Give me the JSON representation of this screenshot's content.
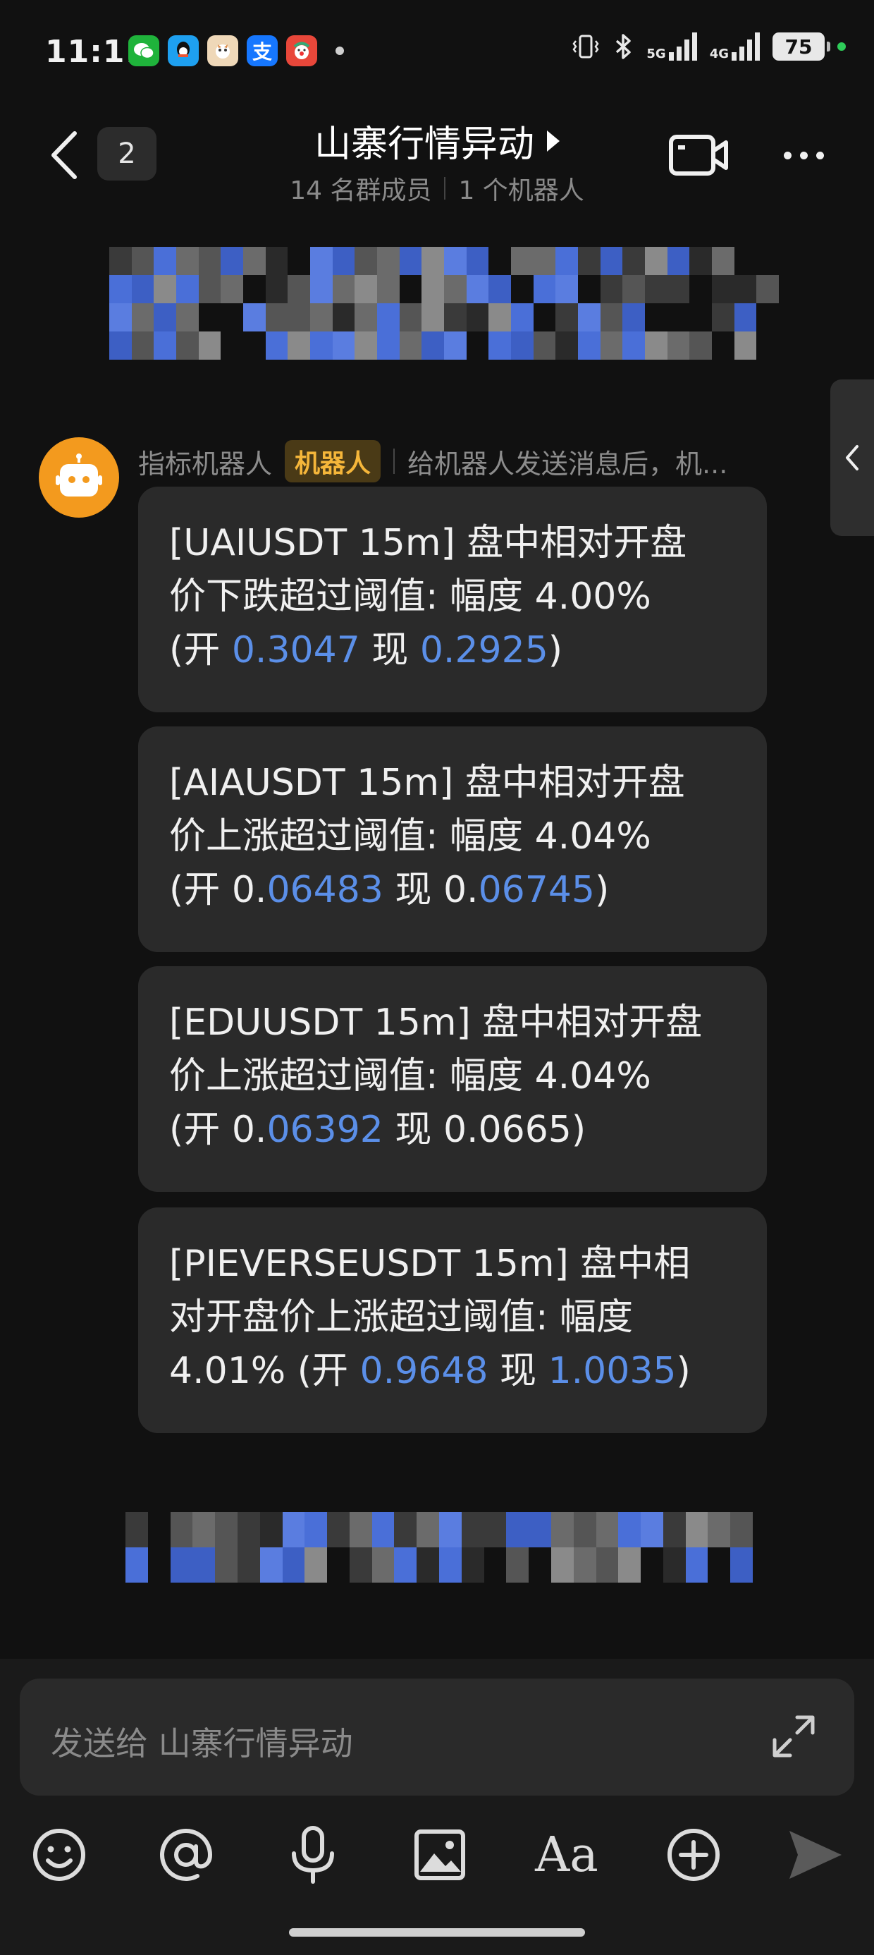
{
  "status_bar": {
    "time": "11:11",
    "apps": [
      {
        "icon": "wechat-icon",
        "color": "#1fb33b",
        "glyph": "●"
      },
      {
        "icon": "qq-icon",
        "color": "#1ea0f0",
        "glyph": "◉"
      },
      {
        "icon": "game-app-icon",
        "color": "#e9d3b5",
        "glyph": "▲"
      },
      {
        "icon": "alipay-icon",
        "color": "#1677ff",
        "glyph": "支"
      },
      {
        "icon": "clown-app-icon",
        "color": "#e8473a",
        "glyph": "☻"
      }
    ],
    "network_1": "5G",
    "network_2": "4G",
    "battery": "75"
  },
  "header": {
    "unread_count": "2",
    "title": "山寨行情异动",
    "member_count": "14 名群成员",
    "bot_count": "1 个机器人"
  },
  "sender": {
    "name": "指标机器人",
    "badge": "机器人",
    "note": "给机器人发送消息后，机..."
  },
  "messages": [
    {
      "line1": "[UAIUSDT 15m] 盘中相对开盘",
      "line2": "价下跌超过阈值: 幅度 4.00%",
      "line3_prefix": "(开 ",
      "open_plain": "",
      "open_link": "0.3047",
      "mid": " 现 ",
      "now_plain": "",
      "now_link": "0.2925",
      "suffix": ")"
    },
    {
      "line1": "[AIAUSDT 15m] 盘中相对开盘",
      "line2": "价上涨超过阈值: 幅度 4.04%",
      "line3_prefix": "(开 ",
      "open_plain": "0.",
      "open_link": "06483",
      "mid": " 现 ",
      "now_plain": "0.",
      "now_link": "06745",
      "suffix": ")"
    },
    {
      "line1": "[EDUUSDT 15m] 盘中相对开盘",
      "line2": "价上涨超过阈值: 幅度 4.04%",
      "line3_prefix": "(开 ",
      "open_plain": "0.",
      "open_link": "06392",
      "mid": " 现 ",
      "now_plain": "0.0665",
      "now_link": "",
      "suffix": ")"
    },
    {
      "line1": "[PIEVERSEUSDT 15m] 盘中相",
      "line2": "对开盘价上涨超过阈值: 幅度",
      "line3_prefix": "4.01% (开 ",
      "open_plain": "",
      "open_link": "0.9648",
      "mid": " 现 ",
      "now_plain": "",
      "now_link": "1.0035",
      "suffix": ")"
    }
  ],
  "composer": {
    "placeholder": "发送给 山寨行情异动",
    "toolbar": [
      "emoji-icon",
      "mention-icon",
      "microphone-icon",
      "image-icon",
      "text-format-icon",
      "add-icon",
      "send-icon"
    ],
    "text_format_label": "Aa"
  },
  "colors": {
    "background": "#111111",
    "bubble": "#2a2a2a",
    "link_number": "#5b8fe8",
    "bot_badge": "#f5b63a",
    "avatar": "#f39a1e"
  }
}
